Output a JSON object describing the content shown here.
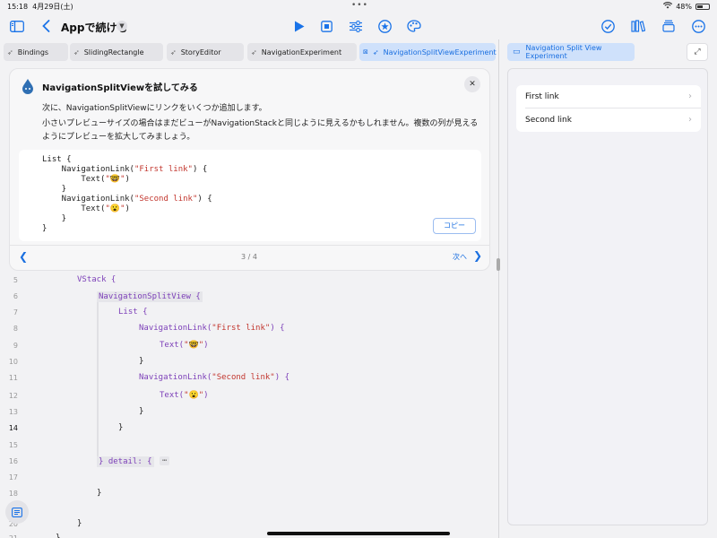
{
  "status_bar": {
    "time": "15:18",
    "date": "4月29日(土)",
    "battery": "48%"
  },
  "toolbar": {
    "app_title": "Appで続ける"
  },
  "tabs": [
    {
      "label": "Bindings"
    },
    {
      "label": "SlidingRectangle"
    },
    {
      "label": "StoryEditor"
    },
    {
      "label": "NavigationExperiment"
    },
    {
      "label": "NavigationSplitViewExperiment"
    }
  ],
  "tutorial": {
    "title": "NavigationSplitViewを試してみる",
    "paragraph1": "次に、NavigationSplitViewにリンクをいくつか追加します。",
    "paragraph2": "小さいプレビューサイズの場合はまだビューがNavigationStackと同じように見えるかもしれません。複数の列が見えるようにプレビューを拡大してみましょう。",
    "code_lines": [
      "List {",
      "    NavigationLink(\"First link\") {",
      "        Text(\"🤓\")",
      "    }",
      "    NavigationLink(\"Second link\") {",
      "        Text(\"😮\")",
      "    }",
      "}"
    ],
    "copy_label": "コピー",
    "page": "3 / 4",
    "next_label": "次へ"
  },
  "editor": {
    "lines": [
      {
        "num": "5",
        "text": "VStack {"
      },
      {
        "num": "6",
        "text": "NavigationSplitView {"
      },
      {
        "num": "7",
        "text": "List {"
      },
      {
        "num": "8",
        "text": "NavigationLink(\"First link\") {"
      },
      {
        "num": "9",
        "text": "Text(\"🤓\")"
      },
      {
        "num": "10",
        "text": "}"
      },
      {
        "num": "11",
        "text": "NavigationLink(\"Second link\") {"
      },
      {
        "num": "12",
        "text": "Text(\"😮\")"
      },
      {
        "num": "13",
        "text": "}"
      },
      {
        "num": "14",
        "text": "}"
      },
      {
        "num": "15",
        "text": ""
      },
      {
        "num": "16",
        "text": "} detail: {"
      },
      {
        "num": "17",
        "text": ""
      },
      {
        "num": "18",
        "text": "}"
      },
      {
        "num": "19",
        "text": ""
      },
      {
        "num": "20",
        "text": "}"
      },
      {
        "num": "21",
        "text": "}"
      }
    ],
    "fold_placeholder": "⋯"
  },
  "preview": {
    "header": "Navigation Split View Experiment",
    "items": [
      {
        "label": "First link"
      },
      {
        "label": "Second link"
      }
    ]
  }
}
